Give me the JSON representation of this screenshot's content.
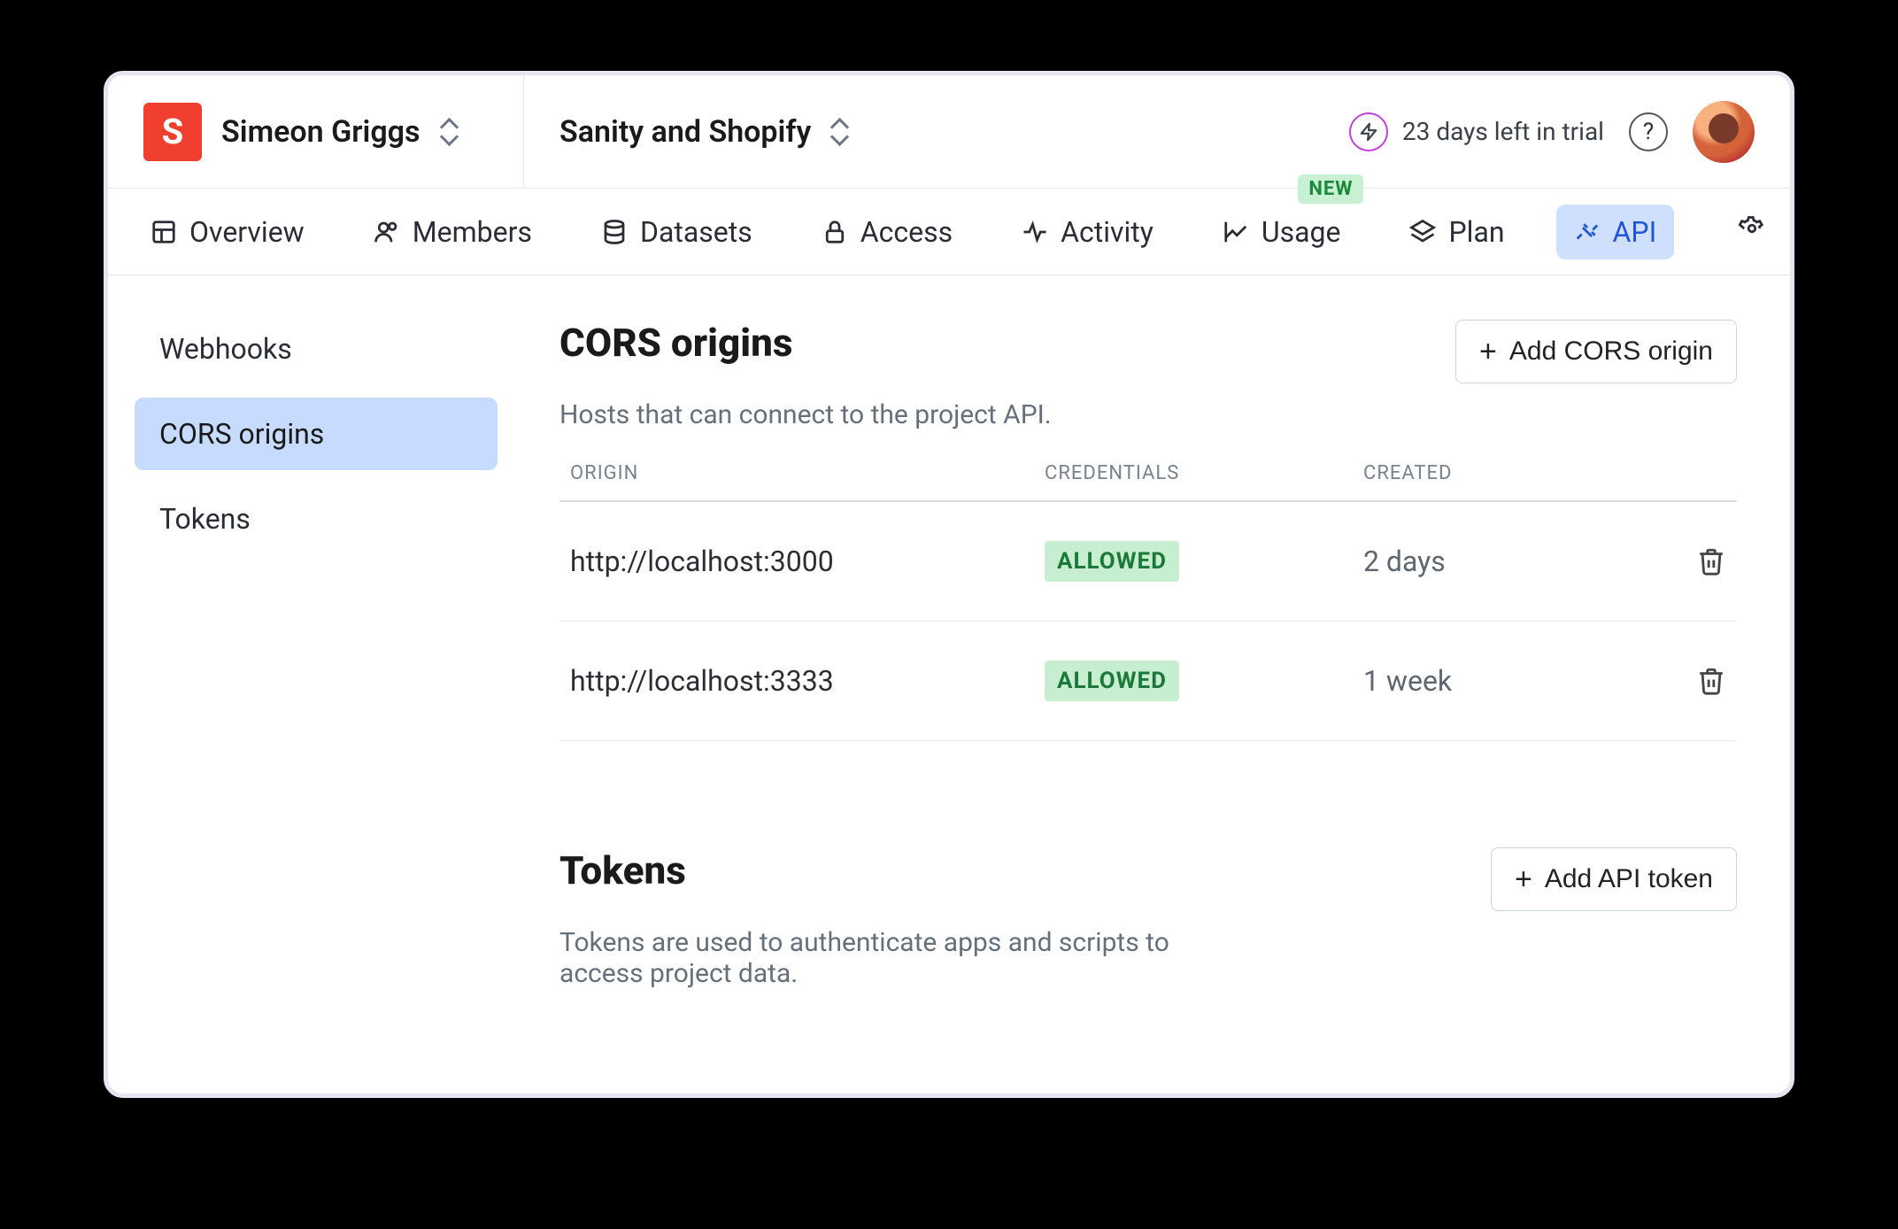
{
  "header": {
    "org_name": "Simeon Griggs",
    "org_logo_letter": "S",
    "project_name": "Sanity and Shopify",
    "trial_text": "23 days left in trial"
  },
  "tabs": [
    {
      "id": "overview",
      "label": "Overview"
    },
    {
      "id": "members",
      "label": "Members"
    },
    {
      "id": "datasets",
      "label": "Datasets"
    },
    {
      "id": "access",
      "label": "Access"
    },
    {
      "id": "activity",
      "label": "Activity"
    },
    {
      "id": "usage",
      "label": "Usage",
      "badge": "NEW"
    },
    {
      "id": "plan",
      "label": "Plan"
    },
    {
      "id": "api",
      "label": "API",
      "active": true
    }
  ],
  "sidebar": {
    "items": [
      {
        "id": "webhooks",
        "label": "Webhooks"
      },
      {
        "id": "cors",
        "label": "CORS origins",
        "active": true
      },
      {
        "id": "tokens",
        "label": "Tokens"
      }
    ]
  },
  "cors": {
    "title": "CORS origins",
    "description": "Hosts that can connect to the project API.",
    "add_button": "Add CORS origin",
    "columns": {
      "origin": "ORIGIN",
      "credentials": "CREDENTIALS",
      "created": "CREATED"
    },
    "rows": [
      {
        "origin": "http://localhost:3000",
        "credentials": "ALLOWED",
        "created": "2 days"
      },
      {
        "origin": "http://localhost:3333",
        "credentials": "ALLOWED",
        "created": "1 week"
      }
    ]
  },
  "tokens": {
    "title": "Tokens",
    "description": "Tokens are used to authenticate apps and scripts to access project data.",
    "add_button": "Add API token"
  }
}
